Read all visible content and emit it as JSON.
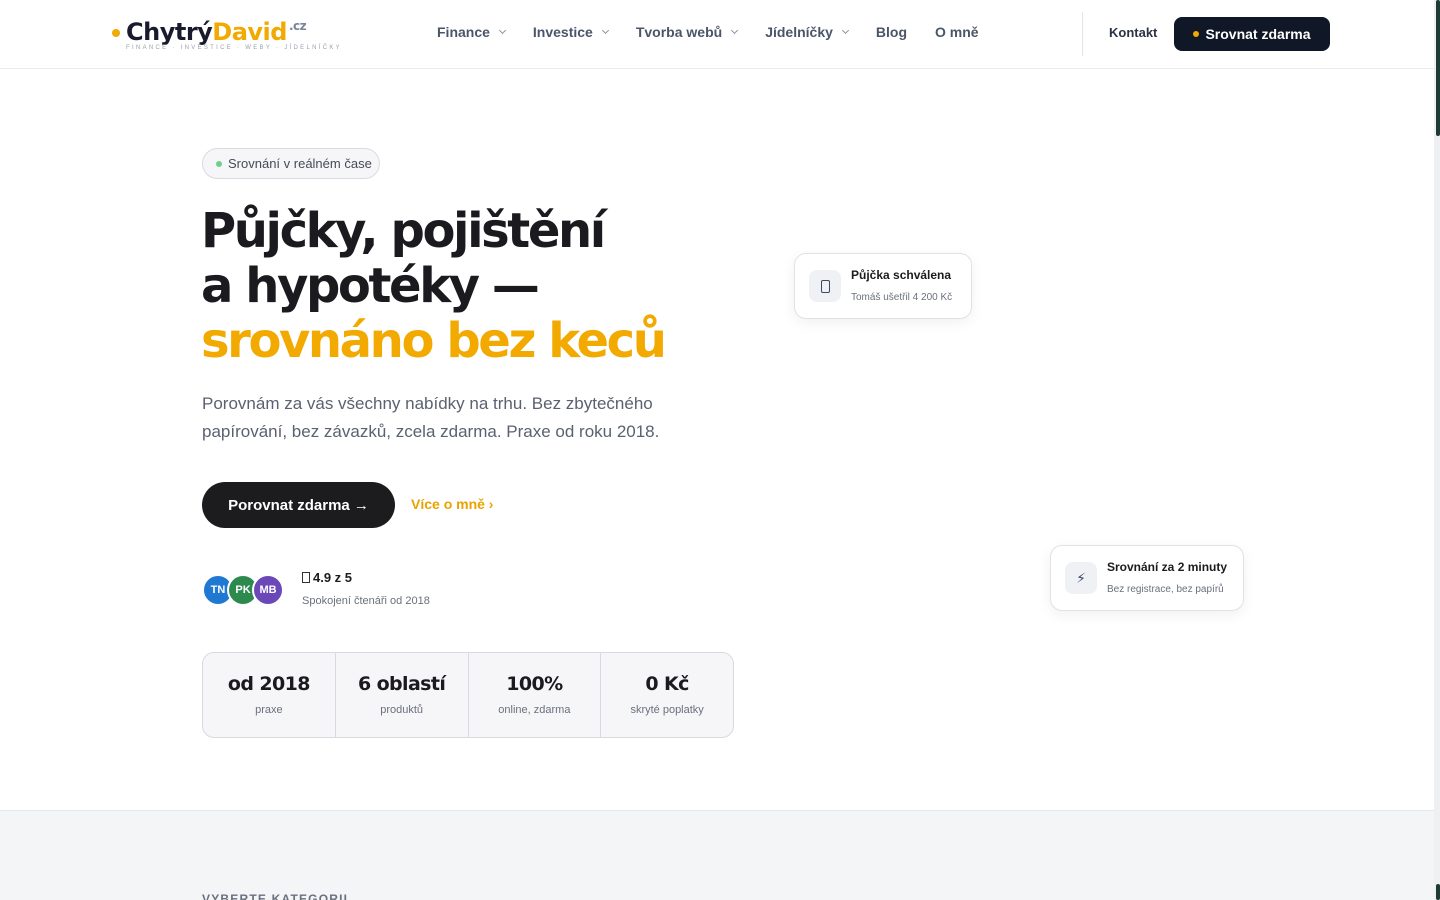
{
  "header": {
    "logo": {
      "part1": "Chytrý",
      "part2": "David",
      "tld": ".cz",
      "tagline": "FINANCE · INVESTICE · WEBY · JÍDELNÍČKY"
    },
    "nav": [
      {
        "label": "Finance",
        "has_dropdown": true
      },
      {
        "label": "Investice",
        "has_dropdown": true
      },
      {
        "label": "Tvorba webů",
        "has_dropdown": true
      },
      {
        "label": "Jídelníčky",
        "has_dropdown": true
      },
      {
        "label": "Blog",
        "has_dropdown": false
      },
      {
        "label": "O mně",
        "has_dropdown": false
      }
    ],
    "kontakt": "Kontakt",
    "cta": "Srovnat zdarma"
  },
  "hero": {
    "badge": "Srovnání v reálném čase",
    "title_line1": "Půjčky, pojištění",
    "title_line2": "a hypotéky —",
    "title_line3": "srovnáno bez keců",
    "lead": "Porovnám za vás všechny nabídky na trhu. Bez zbytečného papírování, bez závazků, zcela zdarma. Praxe od roku 2018.",
    "primary_button": "Porovnat zdarma →",
    "secondary_link": "Více o mně ›",
    "avatars": [
      {
        "initials": "TN",
        "color": "#1f78d1"
      },
      {
        "initials": "PK",
        "color": "#2d8a4e"
      },
      {
        "initials": "MB",
        "color": "#6b48b8"
      }
    ],
    "rating": "4.9 z 5",
    "rating_sub": "Spokojení čtenáři od 2018",
    "stats": [
      {
        "value": "od 2018",
        "label": "praxe"
      },
      {
        "value": "6 oblastí",
        "label": "produktů"
      },
      {
        "value": "100%",
        "label": "online, zdarma"
      },
      {
        "value": "0 Kč",
        "label": "skryté poplatky"
      }
    ]
  },
  "cards": {
    "loan": {
      "title": "Půjčka schválena",
      "sub": "Tomáš ušetřil 4 200 Kč",
      "icon": "phone-icon"
    },
    "compare": {
      "title": "Srovnání za 2 minuty",
      "sub": "Bez registrace, bez papírů",
      "icon": "lightning-icon",
      "glyph": "⚡"
    }
  },
  "section2": {
    "label": "VYBERTE KATEGORII"
  },
  "colors": {
    "accent": "#f2a900",
    "dark": "#101726",
    "badge_dot": "#6ed08a"
  }
}
